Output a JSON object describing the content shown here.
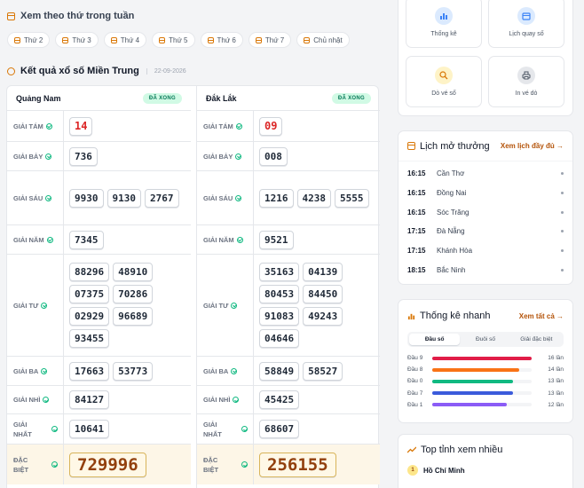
{
  "week": {
    "title": "Xem theo thứ trong tuần",
    "days": [
      "Thứ 2",
      "Thứ 3",
      "Thứ 4",
      "Thứ 5",
      "Thứ 6",
      "Thứ 7",
      "Chủ nhật"
    ]
  },
  "results": {
    "title": "Kết quả xổ số Miền Trung",
    "date": "22-09-2026",
    "provinces": [
      {
        "name": "Quảng Nam",
        "status": "ĐÃ XONG",
        "prizes": {
          "tam": [
            "14"
          ],
          "bay": [
            "736"
          ],
          "sau": [
            "9930",
            "9130",
            "2767"
          ],
          "nam": [
            "7345"
          ],
          "tu": [
            "88296",
            "48910",
            "07375",
            "70286",
            "02929",
            "96689",
            "93455"
          ],
          "ba": [
            "17663",
            "53773"
          ],
          "nhi": [
            "84127"
          ],
          "nhat": [
            "10641"
          ],
          "db": [
            "729996"
          ]
        }
      },
      {
        "name": "Đắk Lắk",
        "status": "ĐÃ XONG",
        "prizes": {
          "tam": [
            "09"
          ],
          "bay": [
            "008"
          ],
          "sau": [
            "1216",
            "4238",
            "5555"
          ],
          "nam": [
            "9521"
          ],
          "tu": [
            "35163",
            "04139",
            "80453",
            "84450",
            "91083",
            "49243",
            "04646"
          ],
          "ba": [
            "58849",
            "58527"
          ],
          "nhi": [
            "45425"
          ],
          "nhat": [
            "68607"
          ],
          "db": [
            "256155"
          ]
        }
      }
    ],
    "labels": {
      "tam": "GIẢI TÁM",
      "bay": "GIẢI BẢY",
      "sau": "GIẢI SÁU",
      "nam": "GIẢI NĂM",
      "tu": "GIẢI TƯ",
      "ba": "GIẢI BA",
      "nhi": "GIẢI NHÌ",
      "nhat_1": "GIẢI",
      "nhat_2": "NHẤT",
      "db_1": "ĐẶC",
      "db_2": "BIỆT"
    }
  },
  "tools": [
    {
      "label": "Thống kê",
      "icon": "chart-icon",
      "color": "#3b82f6",
      "bg": "#dbeafe"
    },
    {
      "label": "Lịch quay số",
      "icon": "calendar-icon",
      "color": "#3b82f6",
      "bg": "#dbeafe"
    },
    {
      "label": "Dò vé số",
      "icon": "search-icon",
      "color": "#d97706",
      "bg": "#fef3c7"
    },
    {
      "label": "In vé dò",
      "icon": "printer-icon",
      "color": "#4b5563",
      "bg": "#e5e7eb"
    }
  ],
  "schedule": {
    "title": "Lịch mở thưởng",
    "link": "Xem lịch đầy đủ →",
    "items": [
      {
        "time": "16:15",
        "name": "Cần Thơ"
      },
      {
        "time": "16:15",
        "name": "Đồng Nai"
      },
      {
        "time": "16:15",
        "name": "Sóc Trăng"
      },
      {
        "time": "17:15",
        "name": "Đà Nẵng"
      },
      {
        "time": "17:15",
        "name": "Khánh Hòa"
      },
      {
        "time": "18:15",
        "name": "Bắc Ninh"
      }
    ]
  },
  "stats": {
    "title": "Thống kê nhanh",
    "link": "Xem tất cả →",
    "tabs": [
      "Đầu số",
      "Đuôi số",
      "Giải đặc biệt"
    ],
    "active_tab": 0,
    "max": 16,
    "items": [
      {
        "key": "Đầu 9",
        "count": 16,
        "text": "16 lần",
        "color": "#e11d48"
      },
      {
        "key": "Đầu 8",
        "count": 14,
        "text": "14 lần",
        "color": "#f97316"
      },
      {
        "key": "Đầu 0",
        "count": 13,
        "text": "13 lần",
        "color": "#10b981"
      },
      {
        "key": "Đầu 7",
        "count": 13,
        "text": "13 lần",
        "color": "#3b5bdb"
      },
      {
        "key": "Đầu 1",
        "count": 12,
        "text": "12 lần",
        "color": "#8b5cf6"
      }
    ]
  },
  "top": {
    "title": "Top tỉnh xem nhiều",
    "items": [
      {
        "rank": "1",
        "name": "Hồ Chí Minh"
      }
    ]
  }
}
